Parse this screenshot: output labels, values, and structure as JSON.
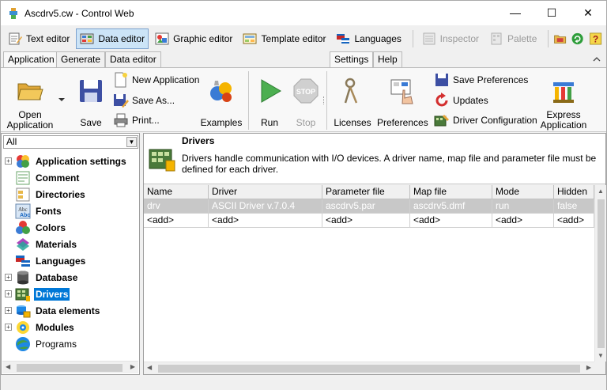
{
  "window": {
    "title": "Ascdrv5.cw - Control Web",
    "minimize_glyph": "—",
    "maximize_glyph": "☐",
    "close_glyph": "✕"
  },
  "editors": [
    {
      "label": "Text editor",
      "icon": "text-editor-icon"
    },
    {
      "label": "Data editor",
      "icon": "data-editor-icon",
      "active": true
    },
    {
      "label": "Graphic editor",
      "icon": "graphic-editor-icon"
    },
    {
      "label": "Template editor",
      "icon": "template-editor-icon"
    },
    {
      "label": "Languages",
      "icon": "languages-icon"
    },
    {
      "label": "Inspector",
      "icon": "inspector-icon",
      "disabled": true
    },
    {
      "label": "Palette",
      "icon": "palette-icon",
      "disabled": true
    }
  ],
  "tabs": {
    "left": [
      "Application",
      "Generate",
      "Data editor"
    ],
    "right": [
      "Settings",
      "Help"
    ],
    "active": [
      "Application",
      "Settings"
    ]
  },
  "ribbon": {
    "open_application": "Open\nApplication",
    "save": "Save",
    "new_application": "New Application",
    "save_as": "Save As...",
    "print": "Print...",
    "examples": "Examples",
    "run": "Run",
    "stop": "Stop",
    "licenses": "Licenses",
    "preferences": "Preferences",
    "save_preferences": "Save Preferences",
    "updates": "Updates",
    "driver_configuration": "Driver Configuration",
    "express_application": "Express\nApplication"
  },
  "tree": {
    "filter": "All",
    "items": [
      {
        "label": "Application settings",
        "expandable": true,
        "icon": "application-settings-icon"
      },
      {
        "label": "Comment",
        "expandable": false,
        "icon": "comment-icon"
      },
      {
        "label": "Directories",
        "expandable": false,
        "icon": "directories-icon"
      },
      {
        "label": "Fonts",
        "expandable": false,
        "icon": "fonts-icon"
      },
      {
        "label": "Colors",
        "expandable": false,
        "icon": "colors-icon"
      },
      {
        "label": "Materials",
        "expandable": false,
        "icon": "materials-icon"
      },
      {
        "label": "Languages",
        "expandable": false,
        "icon": "languages-icon"
      },
      {
        "label": "Database",
        "expandable": true,
        "icon": "database-icon"
      },
      {
        "label": "Drivers",
        "expandable": true,
        "icon": "drivers-icon",
        "selected": true
      },
      {
        "label": "Data elements",
        "expandable": true,
        "icon": "data-elements-icon"
      },
      {
        "label": "Modules",
        "expandable": true,
        "icon": "modules-icon"
      },
      {
        "label": "Programs",
        "expandable": false,
        "icon": "programs-icon",
        "normal": true
      }
    ]
  },
  "details": {
    "title": "Drivers",
    "description": "Drivers handle communication with I/O devices. A driver name, map file and parameter file must be defined for each driver."
  },
  "grid": {
    "columns": [
      "Name",
      "Driver",
      "Parameter file",
      "Map file",
      "Mode",
      "Hidden"
    ],
    "rows": [
      [
        "drv",
        "ASCII Driver v.7.0.4",
        "ascdrv5.par",
        "ascdrv5.dmf",
        "run",
        "false"
      ],
      [
        "<add>",
        "<add>",
        "<add>",
        "<add>",
        "<add>",
        "<add>"
      ]
    ]
  },
  "colors": {
    "selection": "#0078d7",
    "active_editor": "#cce4f7",
    "disabled_text": "#9a9a9a",
    "selected_row": "#c8c8c8"
  }
}
